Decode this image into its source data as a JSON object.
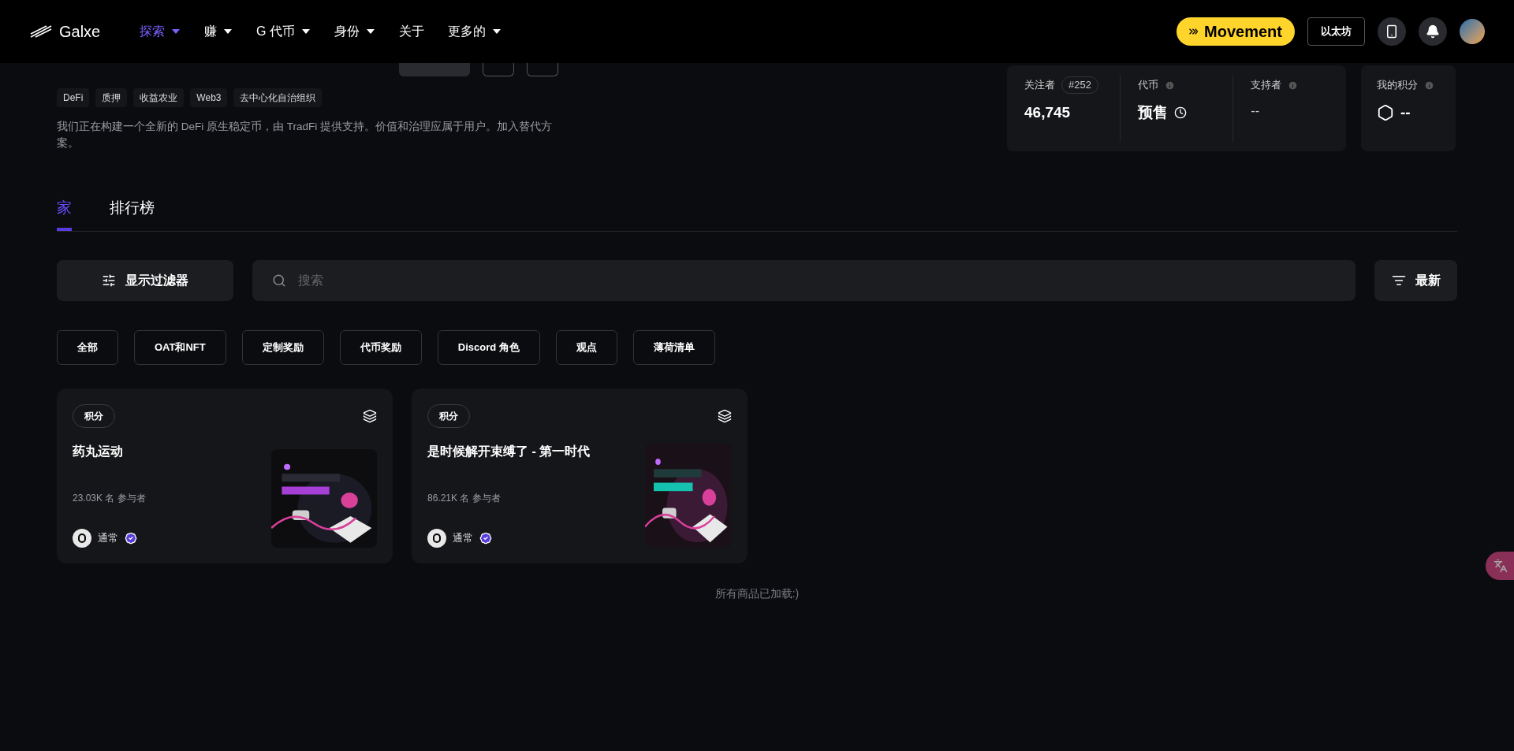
{
  "nav": {
    "logo": "Galxe",
    "items": [
      {
        "label": "探索",
        "selected": true,
        "dropdown": true
      },
      {
        "label": "赚",
        "selected": false,
        "dropdown": true
      },
      {
        "label": "G 代币",
        "selected": false,
        "dropdown": true
      },
      {
        "label": "身份",
        "selected": false,
        "dropdown": true
      },
      {
        "label": "关于",
        "selected": false,
        "dropdown": false
      },
      {
        "label": "更多的",
        "selected": false,
        "dropdown": true
      }
    ],
    "promo": "Movement",
    "network": "以太坊"
  },
  "space": {
    "tags": [
      "DeFi",
      "质押",
      "收益农业",
      "Web3",
      "去中心化自治组织"
    ],
    "description": "我们正在构建一个全新的 DeFi 原生稳定币，由 TradFi 提供支持。价值和治理应属于用户。加入替代方案。",
    "stats": [
      {
        "kind": "followers",
        "label": "关注者",
        "rank": "#252",
        "value": "46,745"
      },
      {
        "kind": "token",
        "label": "代币",
        "value": "预售"
      },
      {
        "kind": "supporters",
        "label": "支持者",
        "value": "--"
      }
    ],
    "my_points": {
      "label": "我的积分",
      "value": "--"
    }
  },
  "tabs": [
    {
      "label": "家",
      "selected": true
    },
    {
      "label": "排行榜",
      "selected": false
    }
  ],
  "toolbar": {
    "filter_button": "显示过滤器",
    "search_placeholder": "搜索",
    "sort": "最新"
  },
  "chips": [
    "全部",
    "OAT和NFT",
    "定制奖励",
    "代币奖励",
    "Discord 角色",
    "观点",
    "薄荷清单"
  ],
  "campaigns": [
    {
      "badge": "积分",
      "title": "药丸运动",
      "participants": "23.03K 名 参与者",
      "host": "通常",
      "verified": true
    },
    {
      "badge": "积分",
      "title": "是时候解开束缚了 - 第一时代",
      "participants": "86.21K 名 参与者",
      "host": "通常",
      "verified": true
    }
  ],
  "footer": "所有商品已加载:)"
}
